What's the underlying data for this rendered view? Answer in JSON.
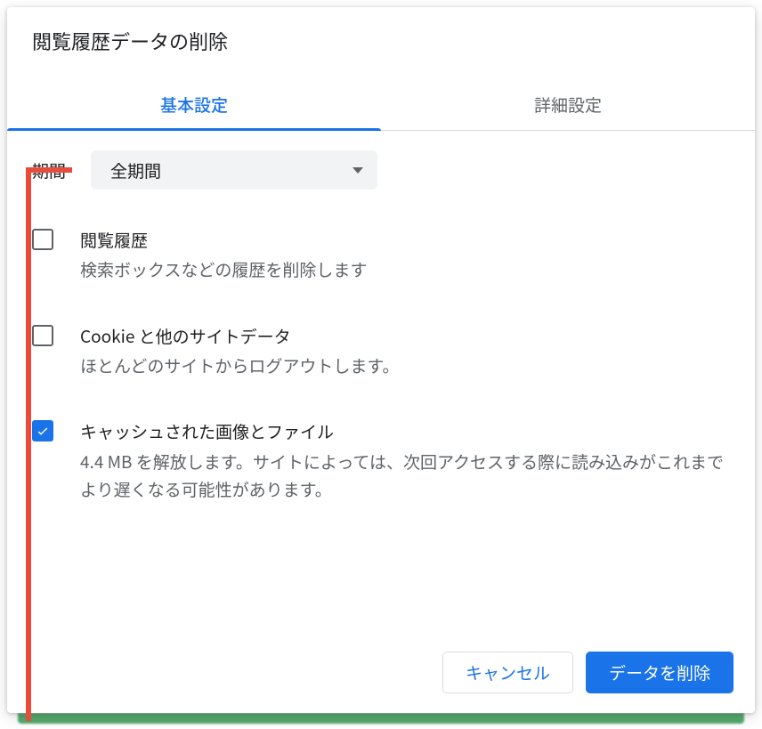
{
  "dialog": {
    "title": "閲覧履歴データの削除",
    "tabs": [
      {
        "label": "基本設定",
        "active": true
      },
      {
        "label": "詳細設定",
        "active": false
      }
    ],
    "range": {
      "label": "期間",
      "selected": "全期間"
    },
    "options": [
      {
        "title": "閲覧履歴",
        "desc": "検索ボックスなどの履歴を削除します",
        "checked": false
      },
      {
        "title": "Cookie と他のサイトデータ",
        "desc": "ほとんどのサイトからログアウトします。",
        "checked": false
      },
      {
        "title": "キャッシュされた画像とファイル",
        "desc": "4.4 MB を解放します。サイトによっては、次回アクセスする際に読み込みがこれまでより遅くなる可能性があります。",
        "checked": true
      }
    ],
    "actions": {
      "cancel": "キャンセル",
      "confirm": "データを削除"
    }
  }
}
